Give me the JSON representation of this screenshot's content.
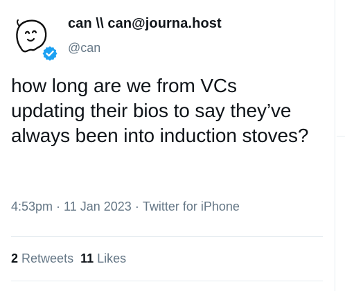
{
  "author": {
    "display_name": "can \\\\ can@journa.host",
    "handle": "@can",
    "verified": true,
    "avatar_icon": "ghost-doodle-icon",
    "verified_icon": "verified-check-icon"
  },
  "tweet": {
    "text": "how long are we from VCs updating their bios to say they’ve always been into induction stoves?",
    "time": "4:53pm",
    "date": "11 Jan 2023",
    "source": "Twitter for iPhone",
    "separator": "·"
  },
  "stats": {
    "retweets_count": "2",
    "retweets_label": "Retweets",
    "likes_count": "11",
    "likes_label": "Likes"
  },
  "colors": {
    "text": "#0f1419",
    "secondary": "#657786",
    "verified": "#1da1f2",
    "divider": "#e6ecf0"
  }
}
